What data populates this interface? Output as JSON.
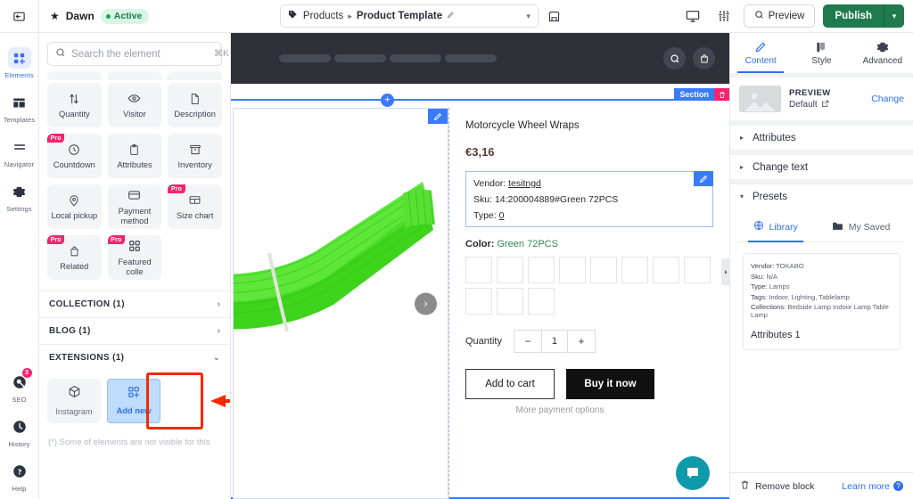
{
  "topbar": {
    "back_icon": "back-arrow-icon",
    "theme_name": "Dawn",
    "status_badge": "Active",
    "breadcrumb": {
      "root": "Products",
      "separator": "▸",
      "current": "Product Template",
      "edit_icon": "pencil-icon",
      "caret": "▾"
    },
    "store_icon": "store-icon",
    "device_icon": "desktop-icon",
    "settings_icon": "sliders-icon",
    "preview_label": "Preview",
    "publish_label": "Publish",
    "publish_caret": "▾",
    "publish_color": "#1f7a4d"
  },
  "rail": {
    "items": [
      {
        "label": "Elements",
        "icon": "elements-grid-icon",
        "active": true
      },
      {
        "label": "Templates",
        "icon": "templates-icon",
        "active": false
      },
      {
        "label": "Navigator",
        "icon": "navigator-lines-icon",
        "active": false
      },
      {
        "label": "Settings",
        "icon": "gear-icon",
        "active": false
      }
    ],
    "bottom_items": [
      {
        "label": "SEO",
        "icon": "seo-magnifier-icon",
        "badge": "3"
      },
      {
        "label": "History",
        "icon": "clock-icon",
        "badge": ""
      },
      {
        "label": "Help",
        "icon": "question-icon",
        "badge": ""
      }
    ]
  },
  "elements_panel": {
    "search": {
      "placeholder": "Search the element",
      "value": "",
      "shortcut": "⌘K",
      "icon": "search-icon"
    },
    "grid": [
      {
        "label": "Quantity",
        "icon": "updown-arrows-icon",
        "pro": false
      },
      {
        "label": "Visitor",
        "icon": "eye-icon",
        "pro": false
      },
      {
        "label": "Description",
        "icon": "document-icon",
        "pro": false
      },
      {
        "label": "Countdown",
        "icon": "clock-icon",
        "pro": true
      },
      {
        "label": "Attributes",
        "icon": "clipboard-icon",
        "pro": false
      },
      {
        "label": "Inventory",
        "icon": "box-icon",
        "pro": false
      },
      {
        "label": "Local pickup",
        "icon": "pin-icon",
        "pro": false
      },
      {
        "label": "Payment method",
        "icon": "card-icon",
        "pro": false
      },
      {
        "label": "Size chart",
        "icon": "table-icon",
        "pro": true
      },
      {
        "label": "Related",
        "icon": "bag-icon",
        "pro": true
      },
      {
        "label": "Featured colle",
        "icon": "grid-icon",
        "pro": true
      }
    ],
    "accordions": [
      {
        "label": "COLLECTION (1)",
        "arrow": "›",
        "expanded": false
      },
      {
        "label": "BLOG (1)",
        "arrow": "›",
        "expanded": false
      },
      {
        "label": "EXTENSIONS (1)",
        "arrow": "⌄",
        "expanded": true
      }
    ],
    "extensions": [
      {
        "label": "Instagram",
        "icon": "cube-icon",
        "highlighted": false
      },
      {
        "label": "Add new",
        "icon": "add-grid-icon",
        "highlighted": true
      }
    ],
    "footnote": "(*) Some of elements are not visible for this",
    "highlight_color": "#fa2600"
  },
  "canvas": {
    "store_header": {
      "nav_placeholders": 4,
      "search_icon": "search-icon",
      "cart_icon": "bag-icon"
    },
    "section_tag": {
      "label": "Section",
      "delete_icon": "trash-icon",
      "color": "#3a7bfd",
      "delete_color": "#f5246c"
    },
    "add_handle": "+",
    "media": {
      "edit_icon": "pencil-icon",
      "next_icon": "›",
      "alt": "green motorcycle wheel wrap bundle"
    },
    "product": {
      "title": "Motorcycle Wheel Wraps",
      "price": "€3,16",
      "attributes": [
        {
          "key": "Vendor:",
          "value": "tesitngd",
          "underline": true
        },
        {
          "key": "Sku:",
          "value": "14:200004889#Green 72PCS",
          "underline": false
        },
        {
          "key": "Type:",
          "value": "0",
          "underline": true
        }
      ],
      "attr_edit_icon": "pencil-icon",
      "color_label": "Color:",
      "color_value": "Green 72PCS",
      "swatch_count": 11,
      "quantity_label": "Quantity",
      "quantity_value": "1",
      "quantity_minus": "−",
      "quantity_plus": "+",
      "add_to_cart": "Add to cart",
      "buy_it_now": "Buy it now",
      "more_payment": "More payment options"
    },
    "chat_icon": "chat-bubble-icon",
    "chat_color": "#0e9aaa",
    "collapse_icon": "chevron-right-icon"
  },
  "right_panel": {
    "tabs": [
      {
        "label": "Content",
        "icon": "pencil-icon",
        "active": true
      },
      {
        "label": "Style",
        "icon": "brush-icon",
        "active": false
      },
      {
        "label": "Advanced",
        "icon": "gear-icon",
        "active": false
      }
    ],
    "preview": {
      "title": "PREVIEW",
      "subtitle": "Default",
      "external_icon": "external-link-icon",
      "change_label": "Change",
      "thumb_icon": "image-placeholder-icon"
    },
    "sections": [
      {
        "label": "Attributes",
        "arrow": "▸",
        "expanded": false
      },
      {
        "label": "Change text",
        "arrow": "▸",
        "expanded": false
      },
      {
        "label": "Presets",
        "arrow": "▾",
        "expanded": true
      }
    ],
    "preset_tabs": [
      {
        "label": "Library",
        "icon": "globe-icon",
        "active": true
      },
      {
        "label": "My Saved",
        "icon": "folder-icon",
        "active": false
      }
    ],
    "preset_card": {
      "lines": [
        {
          "key": "Vendor:",
          "value": "TOKABO"
        },
        {
          "key": "Sku:",
          "value": "N/A"
        },
        {
          "key": "Type:",
          "value": "Lamps"
        },
        {
          "key": "Tags:",
          "value": "Indoor, Lighting, Tablelamp"
        },
        {
          "key": "Collections:",
          "value": "Bedside Lamp Indoor Lamp Table Lamp"
        }
      ],
      "title": "Attributes 1"
    },
    "footer": {
      "remove_label": "Remove block",
      "remove_icon": "trash-icon",
      "learn_label": "Learn more",
      "learn_icon": "question-icon"
    }
  }
}
